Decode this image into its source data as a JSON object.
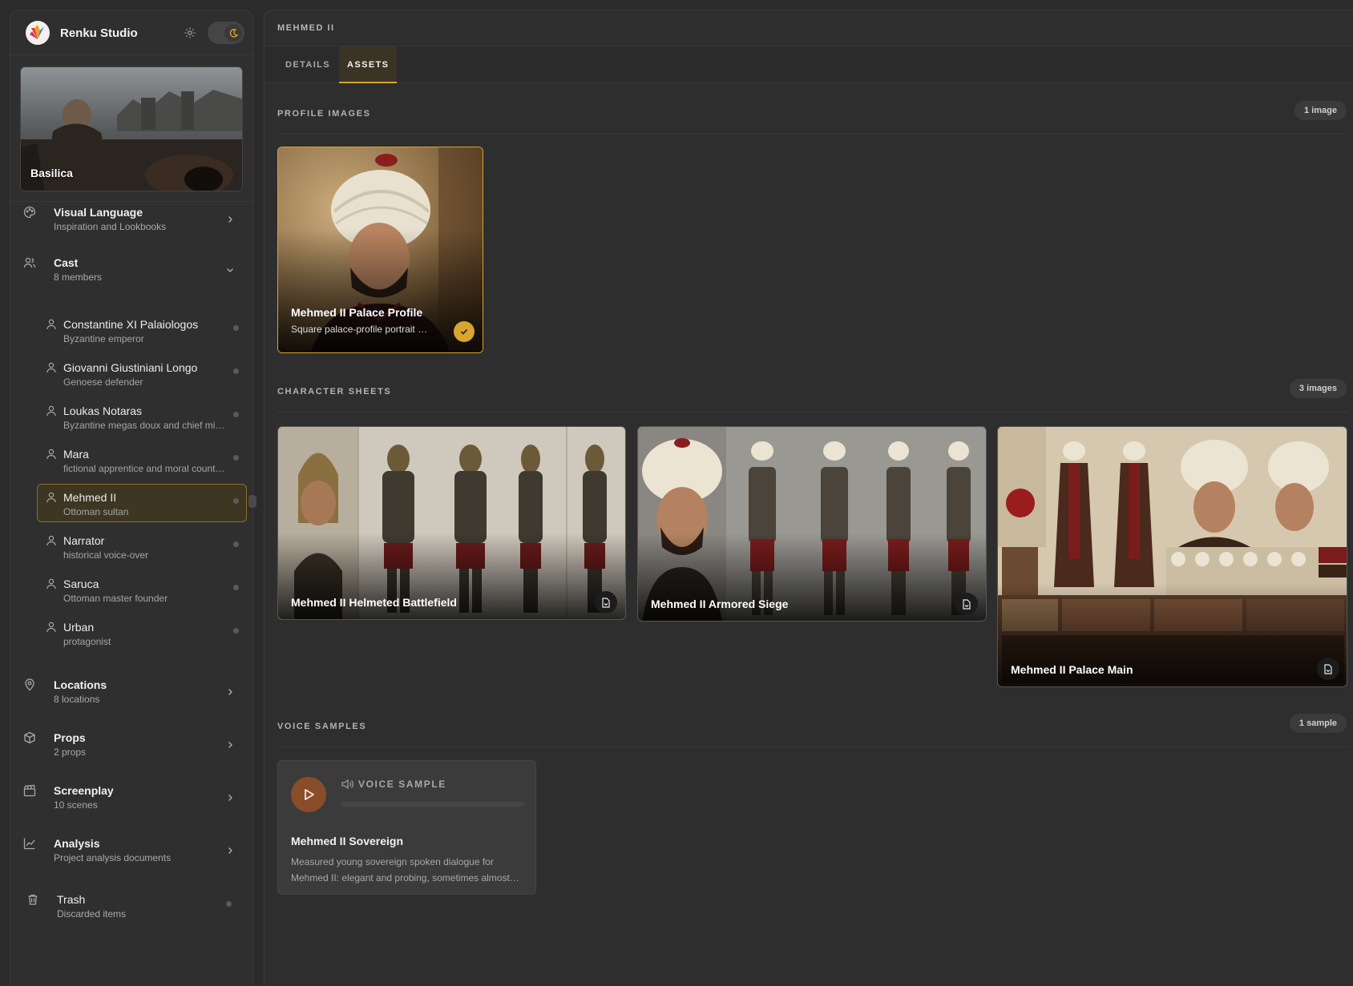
{
  "sidebar": {
    "brand": "Renku Studio",
    "project": {
      "name": "Basilica"
    },
    "sections": {
      "visual_language": {
        "title": "Visual Language",
        "sub": "Inspiration and Lookbooks"
      },
      "cast": {
        "title": "Cast",
        "sub": "8 members"
      },
      "locations": {
        "title": "Locations",
        "sub": "8 locations"
      },
      "props": {
        "title": "Props",
        "sub": "2 props"
      },
      "screenplay": {
        "title": "Screenplay",
        "sub": "10 scenes"
      },
      "analysis": {
        "title": "Analysis",
        "sub": "Project analysis documents"
      },
      "trash": {
        "title": "Trash",
        "sub": "Discarded items"
      }
    },
    "cast_members": [
      {
        "name": "Constantine XI Palaiologos",
        "desc": "Byzantine emperor"
      },
      {
        "name": "Giovanni Giustiniani Longo",
        "desc": "Genoese defender"
      },
      {
        "name": "Loukas Notaras",
        "desc": "Byzantine megas doux and chief mi…"
      },
      {
        "name": "Mara",
        "desc": "fictional apprentice and moral count…"
      },
      {
        "name": "Mehmed II",
        "desc": "Ottoman sultan"
      },
      {
        "name": "Narrator",
        "desc": "historical voice-over"
      },
      {
        "name": "Saruca",
        "desc": "Ottoman master founder"
      },
      {
        "name": "Urban",
        "desc": "protagonist"
      }
    ]
  },
  "main": {
    "title": "MEHMED II",
    "tabs": [
      {
        "label": "DETAILS"
      },
      {
        "label": "ASSETS"
      }
    ],
    "profile_images": {
      "heading": "PROFILE IMAGES",
      "count": "1 image",
      "items": [
        {
          "title": "Mehmed II Palace Profile",
          "sub": "Square palace-profile portrait …"
        }
      ]
    },
    "character_sheets": {
      "heading": "CHARACTER SHEETS",
      "count": "3 images",
      "items": [
        {
          "title": "Mehmed II Helmeted Battlefield"
        },
        {
          "title": "Mehmed II Armored Siege"
        },
        {
          "title": "Mehmed II Palace Main"
        }
      ]
    },
    "voice_samples": {
      "heading": "VOICE SAMPLES",
      "count": "1 sample",
      "items": [
        {
          "label": "VOICE SAMPLE",
          "title": "Mehmed II Sovereign",
          "desc_line1": "Measured young sovereign spoken dialogue for",
          "desc_line2": "Mehmed II: elegant and probing, sometimes almost…"
        }
      ]
    }
  },
  "colors": {
    "accent": "#d9a52e",
    "play": "#8a4d2a",
    "active_bg": "#3d3622"
  }
}
